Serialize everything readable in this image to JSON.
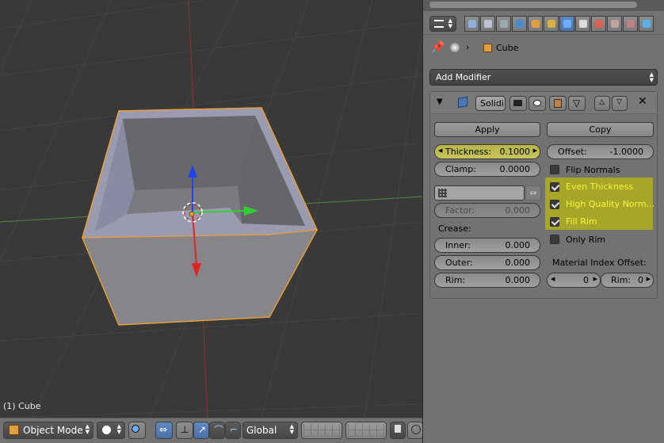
{
  "viewport": {
    "label": "(1) Cube"
  },
  "view_header": {
    "mode": "Object Mode",
    "orientation": "Global",
    "mode_icon": "cube-icon",
    "shading_icon": "sphere-icon"
  },
  "properties": {
    "context_tabs": [
      "render-tab",
      "render-layers-tab",
      "scene-tab",
      "world-tab",
      "object-tab",
      "constraints-tab",
      "modifiers-tab",
      "data-tab",
      "material-tab",
      "texture-tab",
      "particles-tab",
      "physics-tab"
    ],
    "active_tab": "modifiers-tab",
    "breadcrumb": {
      "object": "Cube"
    },
    "add_modifier": "Add Modifier",
    "modifier": {
      "name": "Solidi",
      "apply": "Apply",
      "copy": "Copy",
      "thickness_label": "Thickness:",
      "thickness_value": "0.1000",
      "offset_label": "Offset:",
      "offset_value": "-1.0000",
      "clamp_label": "Clamp:",
      "clamp_value": "0.0000",
      "flip_normals": "Flip Normals",
      "even_thickness": "Even Thickness",
      "high_quality": "High Quality Norm...",
      "fill_rim": "Fill Rim",
      "only_rim": "Only Rim",
      "factor_label": "Factor:",
      "factor_value": "0.000",
      "crease_heading": "Crease:",
      "inner_label": "Inner:",
      "inner_value": "0.000",
      "outer_label": "Outer:",
      "outer_value": "0.000",
      "rim_label": "Rim:",
      "rim_value": "0.000",
      "material_heading": "Material Index Offset:",
      "mat_offset_value": "0",
      "mat_rim_label": "Rim:",
      "mat_rim_value": "0",
      "checkbox_states": {
        "flip_normals": false,
        "even_thickness": true,
        "high_quality": true,
        "fill_rim": true,
        "only_rim": false
      }
    }
  },
  "colors": {
    "highlight": "#b7b547",
    "highlight_text": "#f5f53a",
    "panel": "#727272",
    "viewport_bg": "#393939",
    "selection_outline": "#f0a030"
  }
}
